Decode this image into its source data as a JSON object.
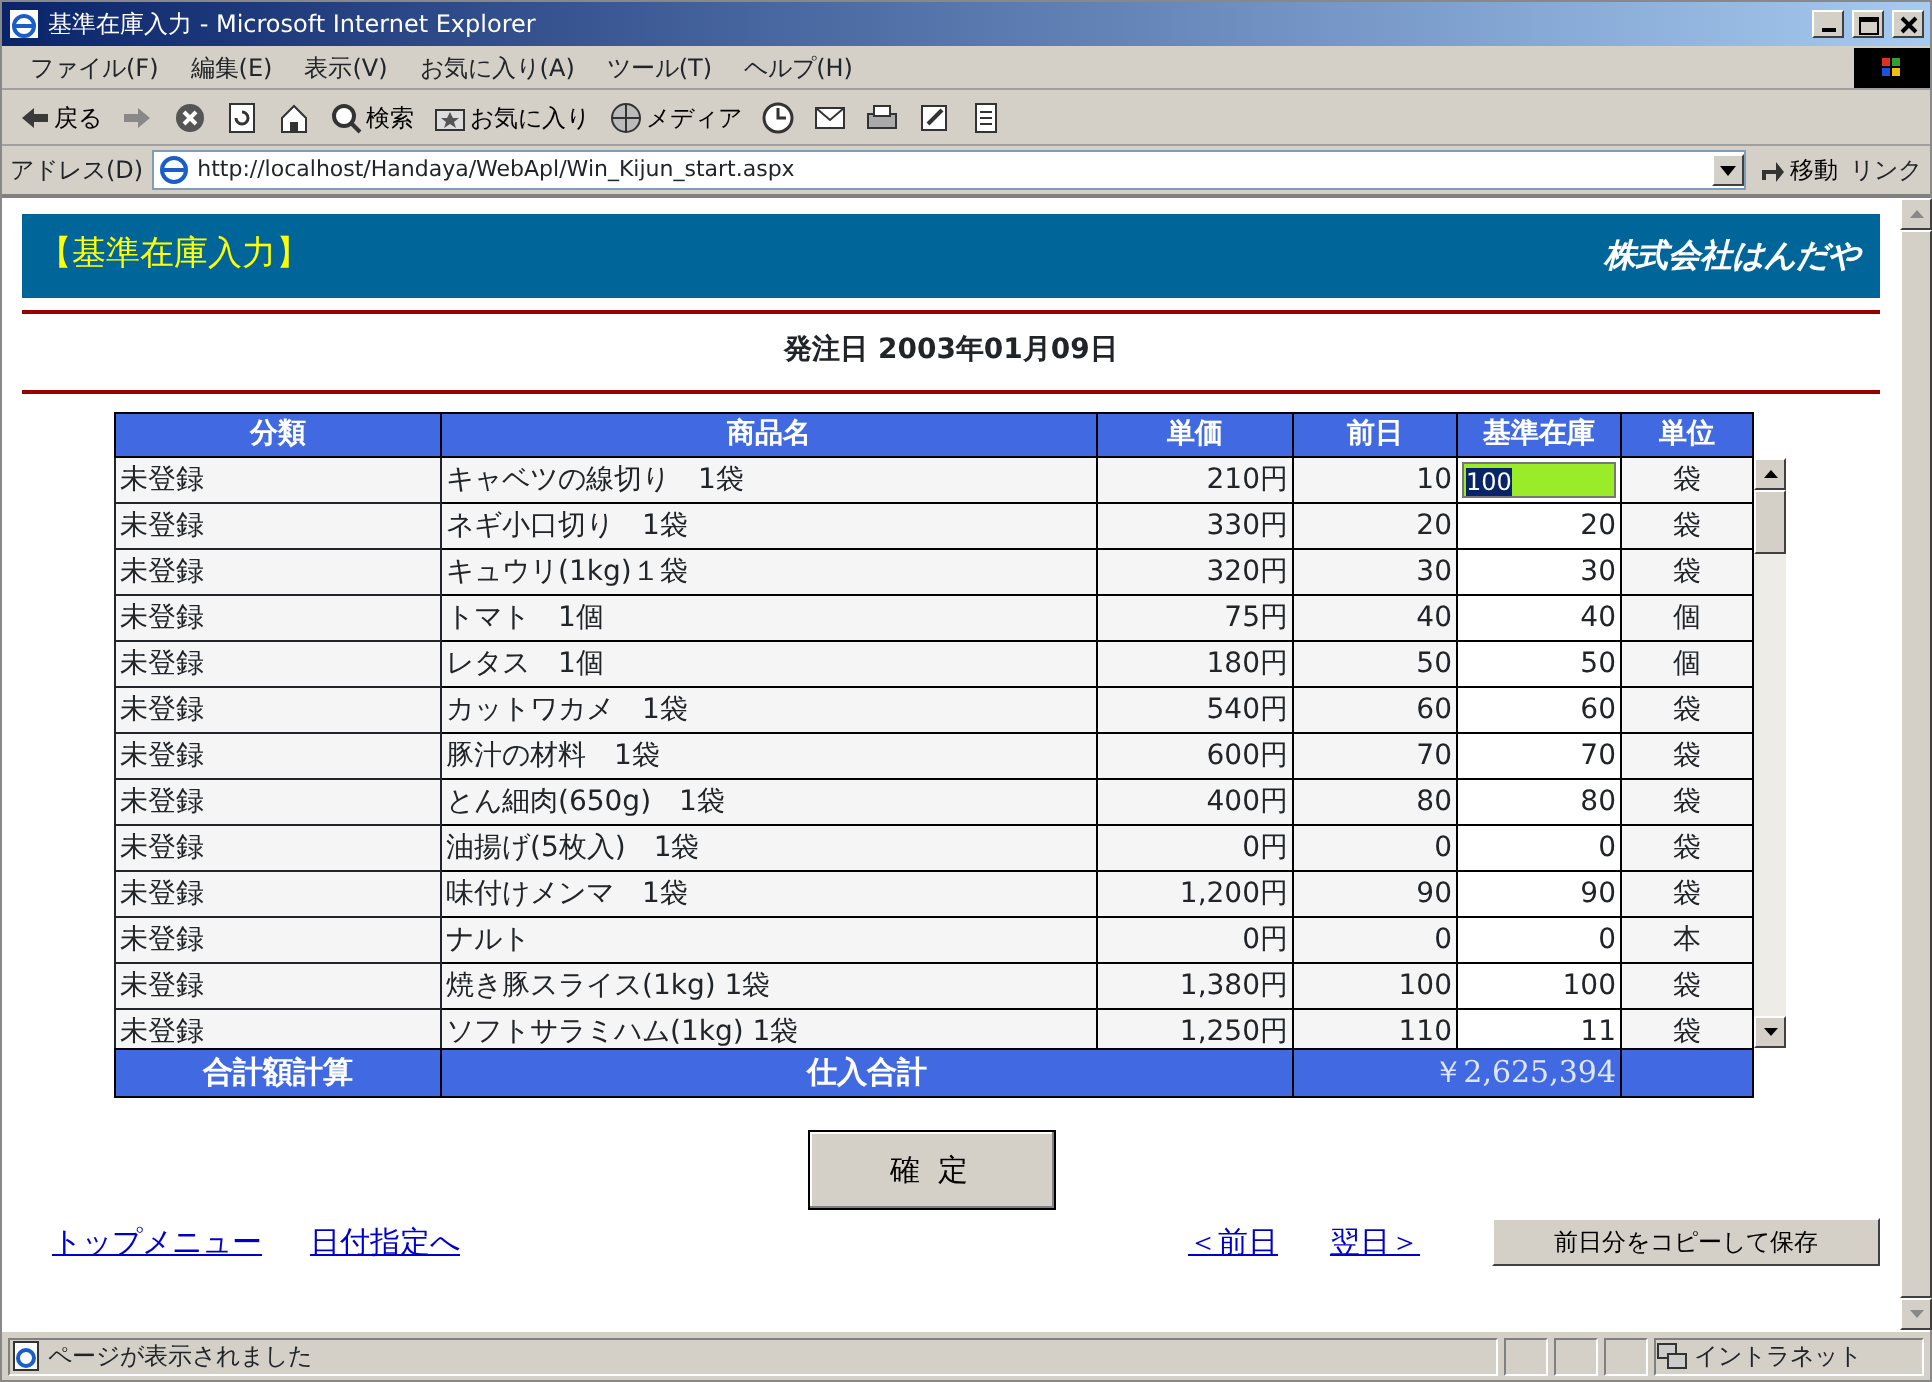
{
  "window": {
    "title": "基準在庫入力 - Microsoft Internet Explorer"
  },
  "menu": [
    "ファイル(F)",
    "編集(E)",
    "表示(V)",
    "お気に入り(A)",
    "ツール(T)",
    "ヘルプ(H)"
  ],
  "toolbar": [
    {
      "kind": "back",
      "label": "戻る"
    },
    {
      "kind": "forward"
    },
    {
      "kind": "stop"
    },
    {
      "kind": "refresh"
    },
    {
      "kind": "home"
    },
    {
      "kind": "search",
      "label": "検索"
    },
    {
      "kind": "favorites",
      "label": "お気に入り"
    },
    {
      "kind": "media",
      "label": "メディア"
    },
    {
      "kind": "history"
    },
    {
      "kind": "mail"
    },
    {
      "kind": "print"
    },
    {
      "kind": "edit"
    },
    {
      "kind": "discuss"
    }
  ],
  "address": {
    "label": "アドレス(D)",
    "url": "http://localhost/Handaya/WebApl/Win_Kijun_start.aspx",
    "go": "移動",
    "links": "リンク"
  },
  "page": {
    "heading": "【基準在庫入力】",
    "company": "株式会社はんだや",
    "date": "発注日  2003年01月09日"
  },
  "table": {
    "columns": [
      "分類",
      "商品名",
      "単価",
      "前日",
      "基準在庫",
      "単位"
    ],
    "rows": [
      {
        "category": "未登録",
        "name": "キャベツの線切り　1袋",
        "price": "210円",
        "previous": "10",
        "stock": "100",
        "unit": "袋",
        "focused": true
      },
      {
        "category": "未登録",
        "name": "ネギ小口切り　1袋",
        "price": "330円",
        "previous": "20",
        "stock": "20",
        "unit": "袋",
        "focused": false
      },
      {
        "category": "未登録",
        "name": "キュウリ(1kg)１袋",
        "price": "320円",
        "previous": "30",
        "stock": "30",
        "unit": "袋",
        "focused": false
      },
      {
        "category": "未登録",
        "name": "トマト　1個",
        "price": "75円",
        "previous": "40",
        "stock": "40",
        "unit": "個",
        "focused": false
      },
      {
        "category": "未登録",
        "name": "レタス　1個",
        "price": "180円",
        "previous": "50",
        "stock": "50",
        "unit": "個",
        "focused": false
      },
      {
        "category": "未登録",
        "name": "カットワカメ　1袋",
        "price": "540円",
        "previous": "60",
        "stock": "60",
        "unit": "袋",
        "focused": false
      },
      {
        "category": "未登録",
        "name": "豚汁の材料　1袋",
        "price": "600円",
        "previous": "70",
        "stock": "70",
        "unit": "袋",
        "focused": false
      },
      {
        "category": "未登録",
        "name": "とん細肉(650g)　1袋",
        "price": "400円",
        "previous": "80",
        "stock": "80",
        "unit": "袋",
        "focused": false
      },
      {
        "category": "未登録",
        "name": "油揚げ(5枚入)　1袋",
        "price": "0円",
        "previous": "0",
        "stock": "0",
        "unit": "袋",
        "focused": false
      },
      {
        "category": "未登録",
        "name": "味付けメンマ　1袋",
        "price": "1,200円",
        "previous": "90",
        "stock": "90",
        "unit": "袋",
        "focused": false
      },
      {
        "category": "未登録",
        "name": "ナルト",
        "price": "0円",
        "previous": "0",
        "stock": "0",
        "unit": "本",
        "focused": false
      },
      {
        "category": "未登録",
        "name": "焼き豚スライス(1kg) 1袋",
        "price": "1,380円",
        "previous": "100",
        "stock": "100",
        "unit": "袋",
        "focused": false
      },
      {
        "category": "未登録",
        "name": "ソフトサラミハム(1kg) 1袋",
        "price": "1,250円",
        "previous": "110",
        "stock": "11",
        "unit": "袋",
        "focused": false
      }
    ],
    "footer": {
      "label": "合計額計算",
      "total_label": "仕入合計",
      "total": "￥2,625,394"
    }
  },
  "confirm_button": "確 定",
  "links": [
    "トップメニュー",
    "日付指定へ",
    "＜前日",
    "翌日＞"
  ],
  "copy_button": "前日分をコピーして保存",
  "status_bar": {
    "text": "ページが表示されました",
    "zone": "イントラネット"
  }
}
